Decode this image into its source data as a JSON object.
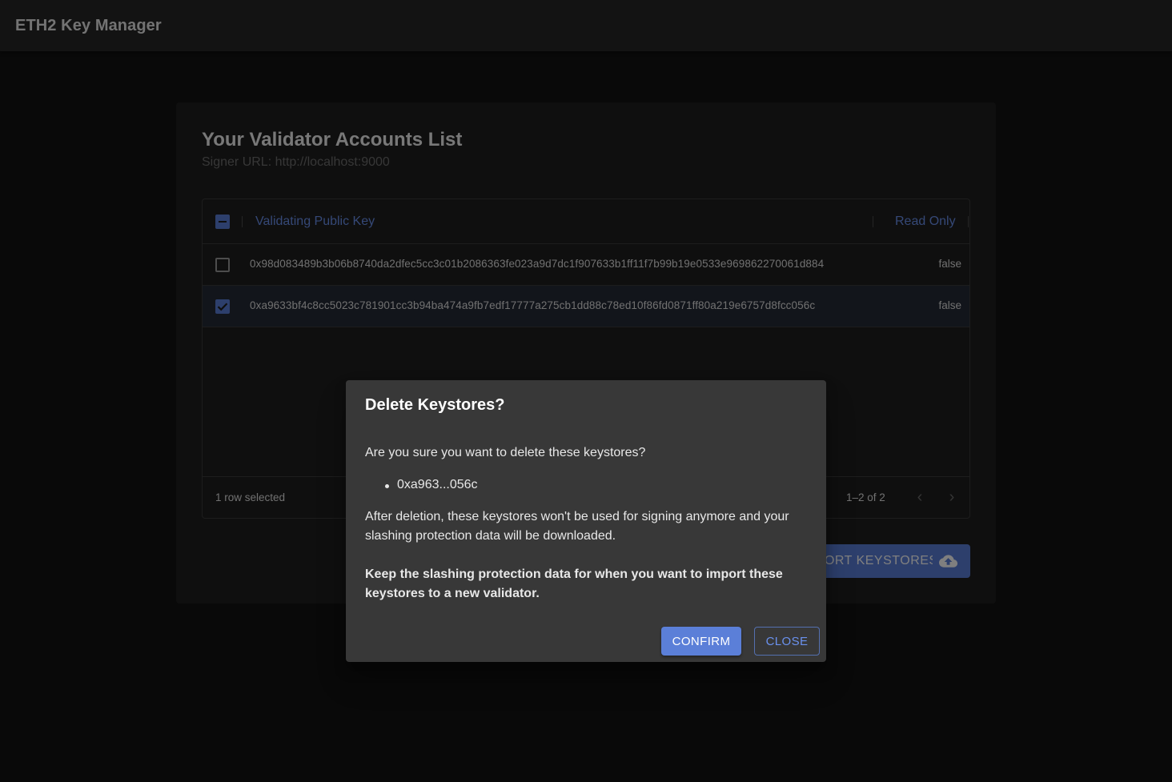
{
  "app": {
    "title": "ETH2 Key Manager"
  },
  "card": {
    "title": "Your Validator Accounts List",
    "subtitle": "Signer URL: http://localhost:9000"
  },
  "table": {
    "columns": [
      "Validating Public Key",
      "Read Only"
    ],
    "rows": [
      {
        "key": "0x98d083489b3b06b8740da2dfec5cc3c01b2086363fe023a9d7dc1f907633b1ff11f7b99b19e0533e969862270061d884",
        "read_only": "false",
        "selected": false
      },
      {
        "key": "0xa9633bf4c8cc5023c781901cc3b94ba474a9fb7edf17777a275cb1dd88c78ed10f86fd0871ff80a219e6757d8fcc056c",
        "read_only": "false",
        "selected": true
      }
    ],
    "footer": {
      "selection_text": "1 row selected",
      "pagination_text": "1–2 of 2"
    }
  },
  "import_button": {
    "label": "IMPORT KEYSTORES",
    "icon": "cloud-upload-icon"
  },
  "dialog": {
    "title": "Delete Keystores?",
    "question": "Are you sure you want to delete these keystores?",
    "items": [
      "0xa963...056c"
    ],
    "warning": "After deletion, these keystores won't be used for signing anymore and your slashing protection data will be downloaded.",
    "note": "Keep the slashing protection data for when you want to import these keystores to a new validator.",
    "confirm_label": "CONFIRM",
    "close_label": "CLOSE"
  },
  "colors": {
    "primary": "#5b7fd8",
    "link": "#6a91ee",
    "dialog_bg": "#383838",
    "page_bg": "#121212"
  }
}
